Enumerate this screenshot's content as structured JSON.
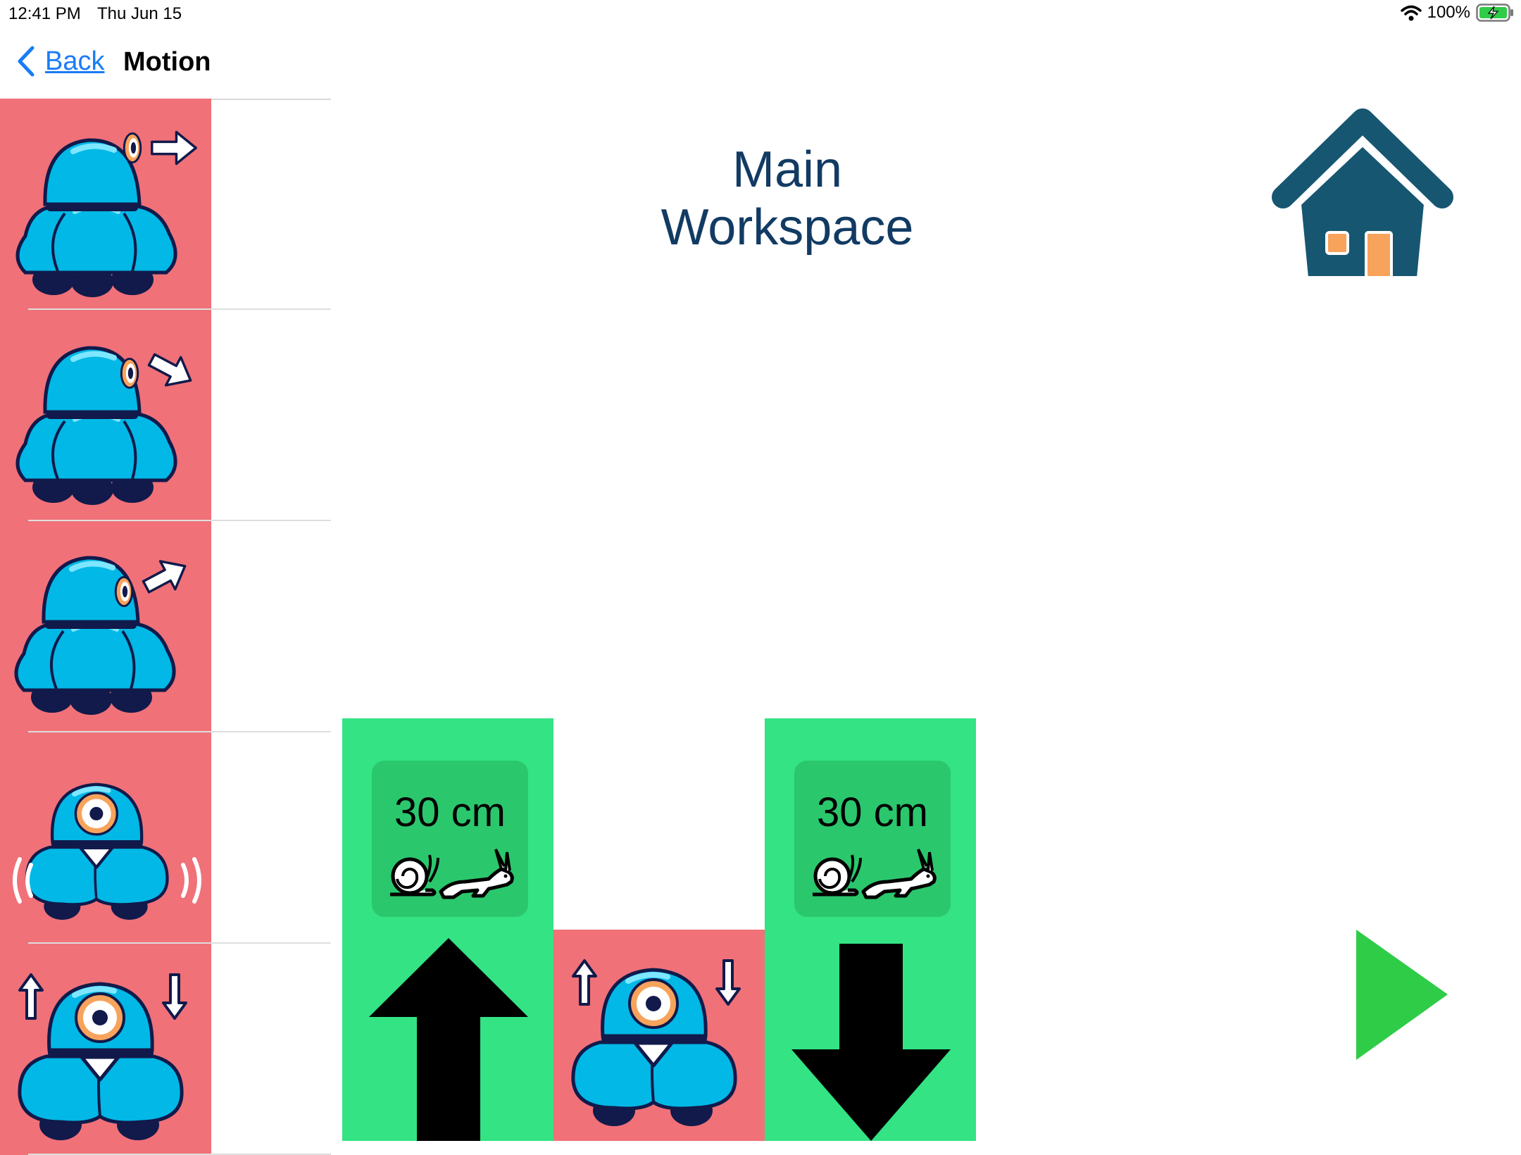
{
  "status_bar": {
    "time": "12:41 PM",
    "date": "Thu Jun 15",
    "battery": "100%",
    "wifi_icon": "wifi-icon",
    "battery_icon": "battery-charging-icon"
  },
  "nav": {
    "back_label": "Back",
    "title": "Motion"
  },
  "palette": [
    {
      "name": "palette-drive-forward",
      "icon": "robot-forward-icon"
    },
    {
      "name": "palette-turn-right",
      "icon": "robot-turn-right-icon"
    },
    {
      "name": "palette-turn-left",
      "icon": "robot-turn-left-icon"
    },
    {
      "name": "palette-wiggle",
      "icon": "robot-wiggle-icon"
    },
    {
      "name": "palette-forward-backward",
      "icon": "robot-forward-backward-icon"
    }
  ],
  "workspace": {
    "title": "Main Workspace",
    "home_icon": "home-icon",
    "play_icon": "play-icon",
    "blocks": [
      {
        "type": "move-forward",
        "distance": "30 cm",
        "icon": "up-arrow-icon",
        "speed_icon": "snail-rabbit-icon"
      },
      {
        "type": "forward-backward",
        "icon": "robot-forward-backward-icon"
      },
      {
        "type": "move-backward",
        "distance": "30 cm",
        "icon": "down-arrow-icon",
        "speed_icon": "snail-rabbit-icon"
      }
    ]
  },
  "colors": {
    "palette_tile": "#f07178",
    "block_green": "#33e384",
    "param_green": "#2bc76d",
    "title": "#123b63",
    "home": "#165671",
    "door": "#f7a35c",
    "play": "#2ecc47",
    "robot_blue": "#02b8e6"
  }
}
